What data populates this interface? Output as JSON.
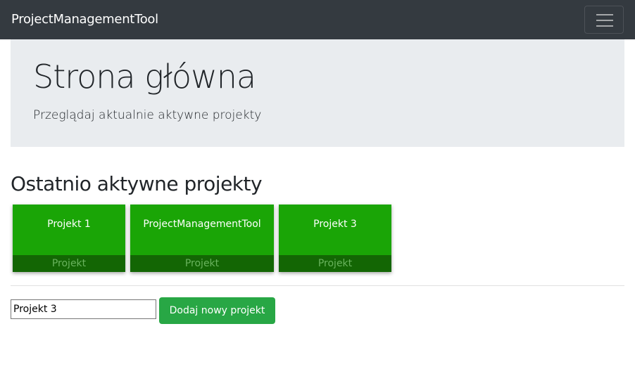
{
  "navbar": {
    "brand": "ProjectManagementTool",
    "menu_icon": "hamburger-icon"
  },
  "jumbotron": {
    "title": "Strona główna",
    "subtitle": "Przeglądaj aktualnie aktywne projekty"
  },
  "recent": {
    "heading": "Ostatnio aktywne projekty",
    "projects": [
      {
        "name": "Projekt 1",
        "type": "Projekt"
      },
      {
        "name": "ProjectManagementTool",
        "type": "Projekt"
      },
      {
        "name": "Projekt 3",
        "type": "Projekt"
      }
    ]
  },
  "form": {
    "input_value": "Projekt 3",
    "add_label": "Dodaj nowy projekt"
  },
  "colors": {
    "navbar": "#343a40",
    "card": "#1aa506",
    "card_footer": "#136604",
    "button": "#28a745"
  }
}
